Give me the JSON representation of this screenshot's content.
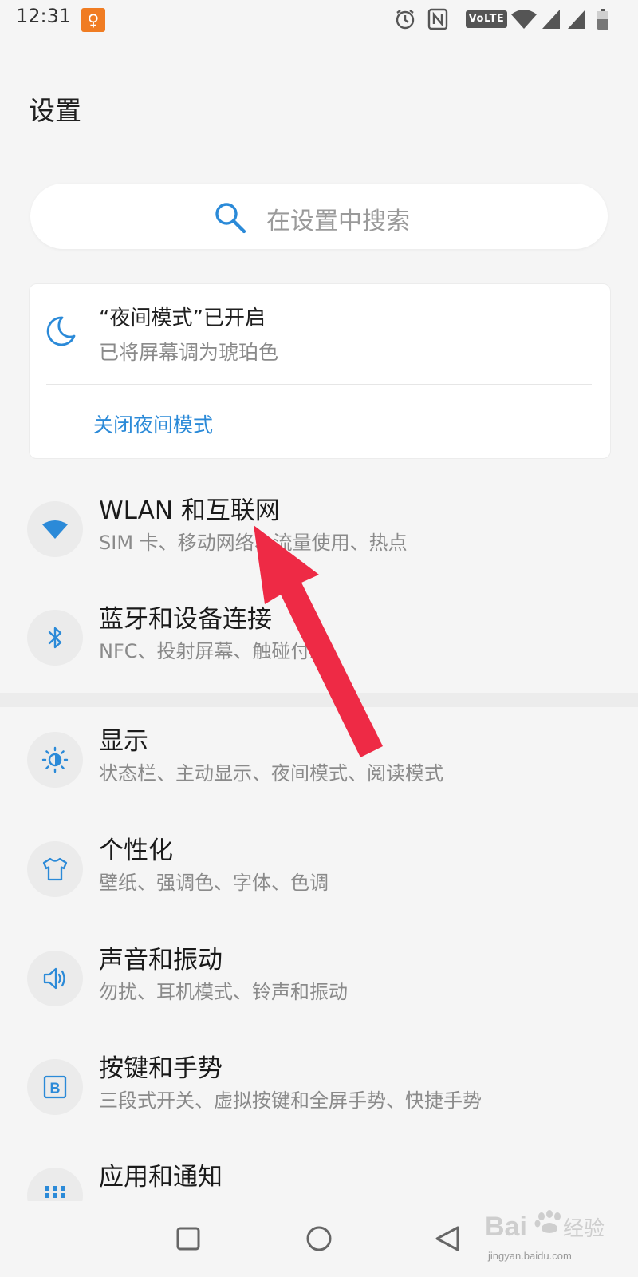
{
  "status_bar": {
    "time": "12:31",
    "volte": "VoLTE"
  },
  "header": {
    "title": "设置"
  },
  "search": {
    "placeholder": "在设置中搜索"
  },
  "night_mode_card": {
    "title": "“夜间模式”已开启",
    "subtitle": "已将屏幕调为琥珀色",
    "action": "关闭夜间模式"
  },
  "settings": [
    {
      "title": "WLAN 和互联网",
      "subtitle": "SIM 卡、移动网络、流量使用、热点",
      "icon": "wifi-icon"
    },
    {
      "title": "蓝牙和设备连接",
      "subtitle": "NFC、投射屏幕、触碰付款",
      "icon": "bluetooth-icon"
    },
    {
      "title": "显示",
      "subtitle": "状态栏、主动显示、夜间模式、阅读模式",
      "icon": "brightness-icon"
    },
    {
      "title": "个性化",
      "subtitle": "壁纸、强调色、字体、色调",
      "icon": "shirt-icon"
    },
    {
      "title": "声音和振动",
      "subtitle": "勿扰、耳机模式、铃声和振动",
      "icon": "speaker-icon"
    },
    {
      "title": "按键和手势",
      "subtitle": "三段式开关、虚拟按键和全屏手势、快捷手势",
      "icon": "b-key-icon"
    },
    {
      "title": "应用和通知",
      "subtitle": "",
      "icon": "apps-grid-icon"
    }
  ],
  "watermark": {
    "text": "jingyan.baidu.com"
  },
  "colors": {
    "accent": "#2b8ad8",
    "arrow": "#ee2a45",
    "background": "#f5f5f5"
  }
}
